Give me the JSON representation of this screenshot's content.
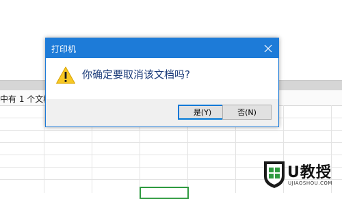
{
  "dialog": {
    "title": "打印机",
    "message": "你确定要取消该文档吗?",
    "yes_label": "是(Y)",
    "no_label": "否(N)",
    "accent_color": "#1d7bd8",
    "close_icon": "close-icon",
    "warning_icon": "warning-icon"
  },
  "background": {
    "status_text": "中有 1 个文档"
  },
  "watermark": {
    "title": "U教授",
    "subtitle": "UJIAOSHOU.COM"
  }
}
